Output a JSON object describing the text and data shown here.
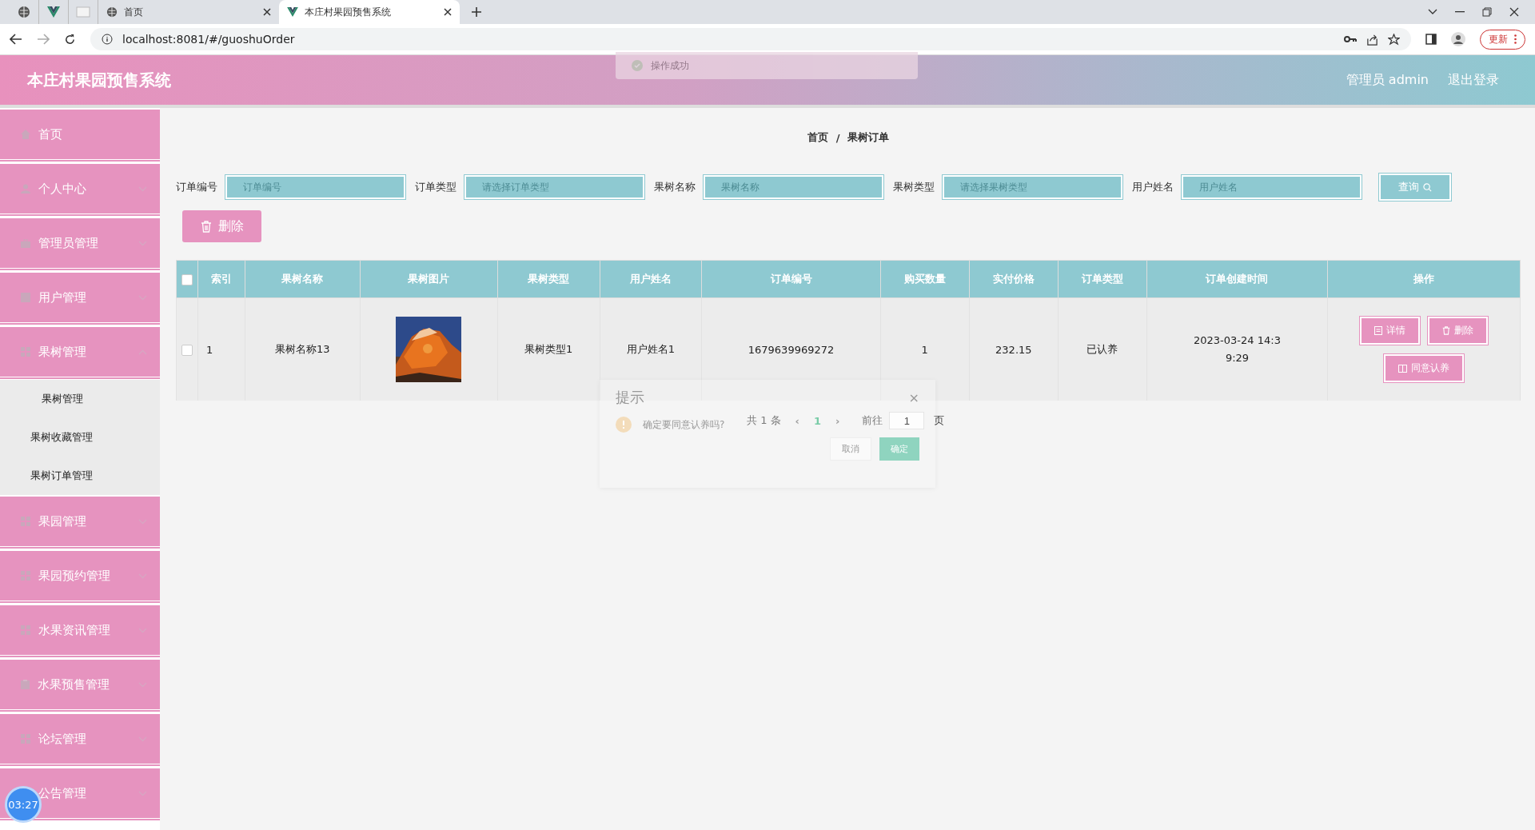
{
  "browser": {
    "tabs": [
      {
        "kind": "pinned-globe",
        "selected": false
      },
      {
        "kind": "pinned-vue",
        "selected": false
      },
      {
        "kind": "pinned-blank",
        "selected": false
      },
      {
        "kind": "page",
        "title": "首页",
        "selected": false
      },
      {
        "kind": "page-vue",
        "title": "本庄村果园预售系统",
        "selected": true
      }
    ],
    "url": "localhost:8081/#/guoshuOrder",
    "update_button": "更新"
  },
  "header": {
    "title": "本庄村果园预售系统",
    "user": "管理员 admin",
    "logout": "退出登录"
  },
  "toast": {
    "message": "操作成功"
  },
  "sidebar": {
    "items": [
      {
        "label": "首页",
        "kind": "home",
        "has_arrow": false
      },
      {
        "label": "个人中心",
        "kind": "user",
        "expanded": false,
        "has_arrow": true
      },
      {
        "label": "管理员管理",
        "kind": "case",
        "expanded": false,
        "has_arrow": true
      },
      {
        "label": "用户管理",
        "kind": "square",
        "expanded": false,
        "has_arrow": true
      },
      {
        "label": "果树管理",
        "kind": "grid",
        "expanded": true,
        "has_arrow": true,
        "children": [
          {
            "label": "果树管理"
          },
          {
            "label": "果树收藏管理"
          },
          {
            "label": "果树订单管理"
          }
        ]
      },
      {
        "label": "果园管理",
        "kind": "grid",
        "expanded": false,
        "has_arrow": true
      },
      {
        "label": "果园预约管理",
        "kind": "grid",
        "expanded": false,
        "has_arrow": true
      },
      {
        "label": "水果资讯管理",
        "kind": "grid",
        "expanded": false,
        "has_arrow": true
      },
      {
        "label": "水果预售管理",
        "kind": "clip",
        "expanded": false,
        "has_arrow": true
      },
      {
        "label": "论坛管理",
        "kind": "grid",
        "expanded": false,
        "has_arrow": true
      },
      {
        "label": "公告管理",
        "expanded": false,
        "has_arrow": true
      }
    ]
  },
  "breadcrumb": {
    "items": [
      "首页",
      "果树订单"
    ],
    "separator": "/"
  },
  "filters": [
    {
      "label": "订单编号",
      "placeholder": "订单编号"
    },
    {
      "label": "订单类型",
      "placeholder": "请选择订单类型"
    },
    {
      "label": "果树名称",
      "placeholder": "果树名称"
    },
    {
      "label": "果树类型",
      "placeholder": "请选择果树类型"
    },
    {
      "label": "用户姓名",
      "placeholder": "用户姓名"
    }
  ],
  "search_button": "查询",
  "delete_button": "删除",
  "table": {
    "select_all": false,
    "columns": [
      "索引",
      "果树名称",
      "果树图片",
      "果树类型",
      "用户姓名",
      "订单编号",
      "购买数量",
      "实付价格",
      "订单类型",
      "订单创建时间",
      "操作"
    ],
    "rows": [
      {
        "checked": false,
        "index": "1",
        "name": "果树名称13",
        "type": "果树类型1",
        "user": "用户姓名1",
        "order_no": "1679639969272",
        "quantity": "1",
        "price": "232.15",
        "order_type": "已认养",
        "created": "2023-03-24 14:3\n9:29",
        "actions": [
          {
            "label": "详情",
            "kind": "doc"
          },
          {
            "label": "删除",
            "kind": "trash"
          },
          {
            "label": "同意认养",
            "kind": "book"
          }
        ]
      }
    ]
  },
  "pagination": {
    "total": "共 1 条",
    "prev": "‹",
    "pages": [
      {
        "label": "1",
        "selected": true
      }
    ],
    "next": "›",
    "goto": "前往",
    "page_input": "1",
    "page_unit": "页"
  },
  "dialog": {
    "title": "提示",
    "close": "×",
    "message": "确定要同意认养吗?",
    "cancel": "取消",
    "confirm": "确定"
  },
  "timer": "03:27"
}
